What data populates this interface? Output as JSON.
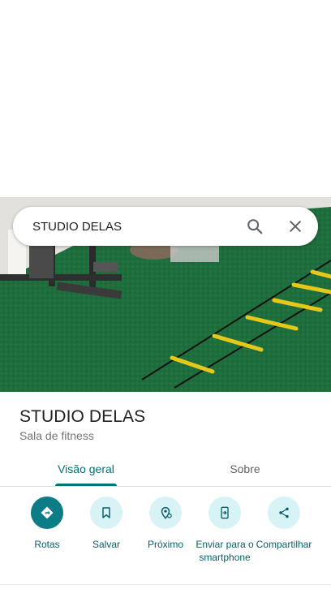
{
  "search": {
    "query": "STUDIO DELAS"
  },
  "place": {
    "name": "STUDIO DELAS",
    "category": "Sala de fitness"
  },
  "tabs": [
    {
      "label": "Visão geral",
      "selected": true
    },
    {
      "label": "Sobre",
      "selected": false
    }
  ],
  "actions": [
    {
      "label": "Rotas",
      "icon": "directions-icon"
    },
    {
      "label": "Salvar",
      "icon": "bookmark-icon"
    },
    {
      "label": "Próximo",
      "icon": "nearby-icon"
    },
    {
      "label": "Enviar para o smartphone",
      "icon": "send-to-phone-icon"
    },
    {
      "label": "Compartilhar",
      "icon": "share-icon"
    }
  ],
  "colors": {
    "accent": "#01717a",
    "action_bg": "#d8f3f6",
    "primary_action_bg": "#0c7c86"
  }
}
